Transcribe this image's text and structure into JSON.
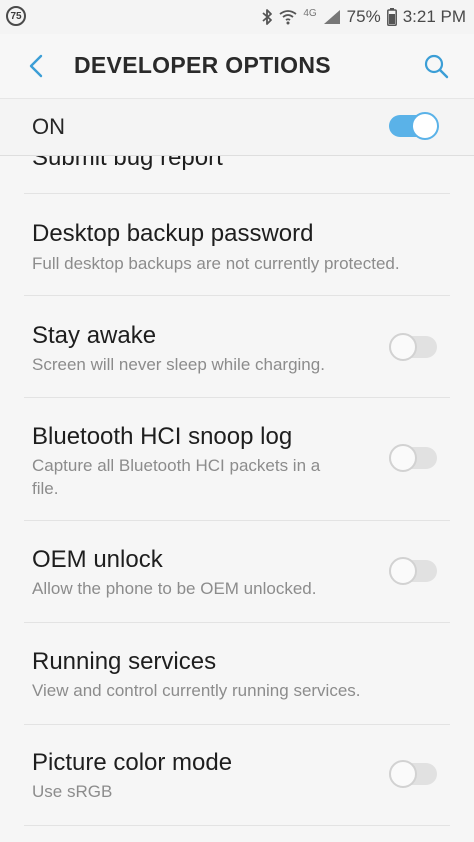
{
  "status_bar": {
    "notification_badge": "75",
    "network_label": "4G",
    "battery_percent": "75%",
    "time": "3:21 PM",
    "icons": [
      "bluetooth-icon",
      "wifi-icon",
      "signal-icon",
      "battery-icon"
    ]
  },
  "app_bar": {
    "title": "DEVELOPER OPTIONS",
    "back_icon": "chevron-left-icon",
    "search_icon": "search-icon"
  },
  "master_switch": {
    "label": "ON",
    "state": true
  },
  "items": [
    {
      "title": "Submit bug report",
      "summary": "",
      "has_toggle": false
    },
    {
      "title": "Desktop backup password",
      "summary": "Full desktop backups are not currently protected.",
      "has_toggle": false
    },
    {
      "title": "Stay awake",
      "summary": "Screen will never sleep while charging.",
      "has_toggle": true,
      "toggle_on": false
    },
    {
      "title": "Bluetooth HCI snoop log",
      "summary": "Capture all Bluetooth HCI packets in a file.",
      "has_toggle": true,
      "toggle_on": false
    },
    {
      "title": "OEM unlock",
      "summary": "Allow the phone to be OEM unlocked.",
      "has_toggle": true,
      "toggle_on": false
    },
    {
      "title": "Running services",
      "summary": "View and control currently running services.",
      "has_toggle": false
    },
    {
      "title": "Picture color mode",
      "summary": "Use sRGB",
      "has_toggle": true,
      "toggle_on": false
    }
  ],
  "colors": {
    "accent": "#5ab2e8",
    "title_text": "#1e1e1e",
    "summary_text": "#8c8c8c",
    "background": "#f6f6f6"
  }
}
